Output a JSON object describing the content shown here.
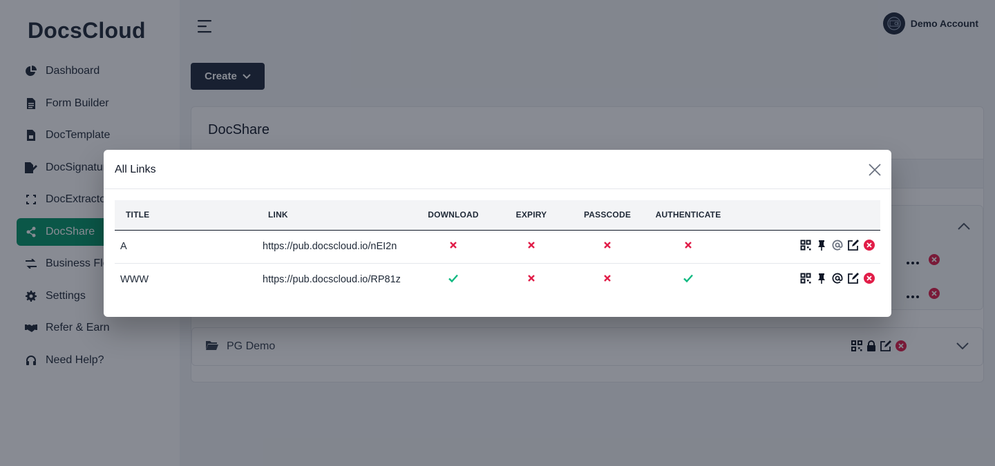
{
  "app": {
    "brand": "DocsCloud",
    "account_name": "Demo Account"
  },
  "sidebar": {
    "items": [
      {
        "label": "Dashboard",
        "icon": "pie-chart-icon"
      },
      {
        "label": "Form Builder",
        "icon": "document-icon"
      },
      {
        "label": "DocTemplate",
        "icon": "template-icon"
      },
      {
        "label": "DocSignature",
        "icon": "signature-icon"
      },
      {
        "label": "DocExtractor",
        "icon": "extract-icon"
      },
      {
        "label": "DocShare",
        "icon": "share-icon",
        "active": true
      },
      {
        "label": "Business Flow",
        "icon": "exchange-icon"
      },
      {
        "label": "Settings",
        "icon": "gear-icon"
      },
      {
        "label": "Refer & Earn",
        "icon": "handshake-icon"
      },
      {
        "label": "Need Help?",
        "icon": "headset-icon"
      }
    ]
  },
  "toolbar": {
    "create_label": "Create"
  },
  "card": {
    "title": "DocShare"
  },
  "folders": [
    {
      "name": "PG Demo"
    }
  ],
  "modal": {
    "title": "All Links",
    "columns": [
      "TITLE",
      "LINK",
      "DOWNLOAD",
      "EXPIRY",
      "PASSCODE",
      "AUTHENTICATE",
      ""
    ],
    "rows": [
      {
        "title": "A",
        "link": "https://pub.docscloud.io/nEI2n",
        "download": false,
        "expiry": false,
        "passcode": false,
        "authenticate": false
      },
      {
        "title": "WWW",
        "link": "https://pub.docscloud.io/RP81z",
        "download": true,
        "expiry": false,
        "passcode": false,
        "authenticate": true
      }
    ]
  },
  "colors": {
    "accent": "#059669",
    "dark": "#1e293b",
    "danger": "#e11d48",
    "success": "#10b981"
  }
}
